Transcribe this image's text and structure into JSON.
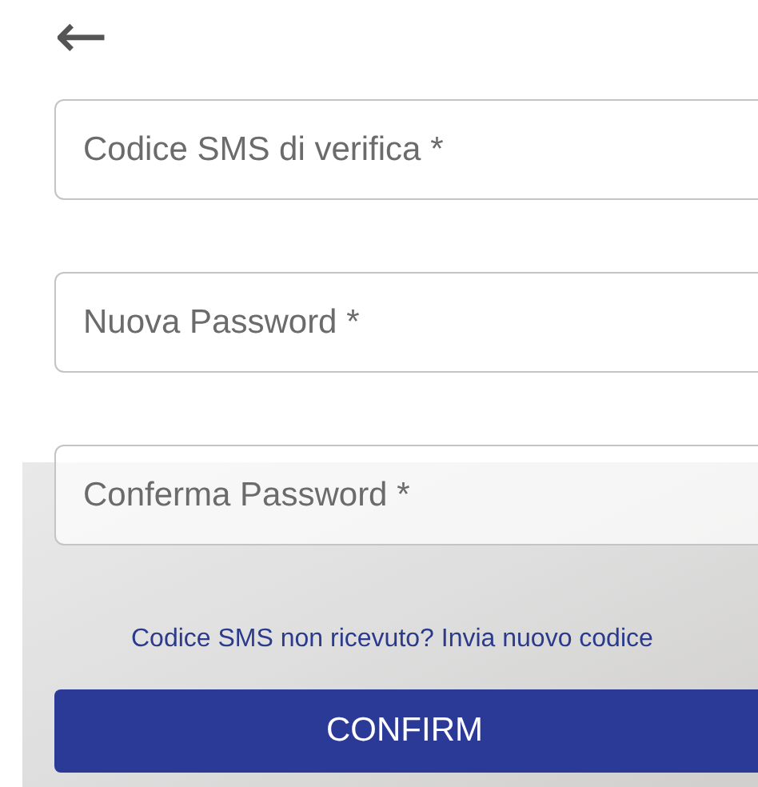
{
  "back_button": {
    "label": "←"
  },
  "fields": [
    {
      "placeholder": "Codice SMS di verifica *"
    },
    {
      "placeholder": "Nuova Password *"
    },
    {
      "placeholder": "Conferma Password *"
    }
  ],
  "resend_link": "Codice SMS non ricevuto? Invia nuovo codice",
  "confirm_button": "CONFIRM"
}
